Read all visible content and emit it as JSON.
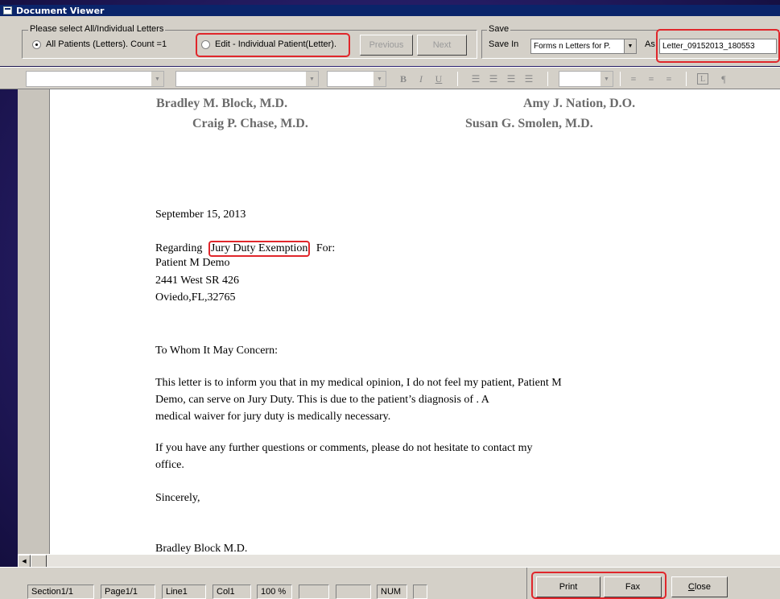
{
  "window": {
    "title": "Document Viewer"
  },
  "options": {
    "select_legend": "Please select All/Individual Letters",
    "all_patients_label": "All Patients (Letters). Count =1",
    "edit_individual_label": "Edit -  Individual Patient(Letter).",
    "previous_label": "Previous",
    "next_label": "Next",
    "save_legend": "Save",
    "save_in_label": "Save In",
    "save_in_value": "Forms n Letters for P.",
    "as_label": "As",
    "as_value": "Letter_09152013_180553"
  },
  "format_toolbar": {
    "bold": "B",
    "italic": "I",
    "underline": "U",
    "pilcrow": "¶"
  },
  "document": {
    "header": {
      "doctor1": "Bradley M. Block, M.D.",
      "doctor2": "Amy J. Nation, D.O.",
      "doctor3": "Craig P. Chase, M.D.",
      "doctor4": "Susan G. Smolen, M.D."
    },
    "date": "September 15, 2013",
    "regarding_prefix": "Regarding",
    "regarding_subject": "Jury Duty Exemption",
    "regarding_suffix": "For:",
    "patient_name": "Patient M Demo",
    "address_line1": "2441 West SR 426",
    "address_line2": "Oviedo,FL,32765",
    "salutation": "To Whom It May Concern:",
    "body1_line1": "This letter is to inform you that in my medical opinion, I do not feel my patient, Patient M",
    "body1_line2": "Demo, can serve on Jury Duty.  This is due to the patient’s diagnosis of              .  A",
    "body1_line3": "medical waiver for jury duty is medically necessary.",
    "body2_line1": "If you have any further questions or comments, please do not hesitate to contact my",
    "body2_line2": "office.",
    "closing": "Sincerely,",
    "signature": "Bradley Block M.D."
  },
  "status": {
    "section": "Section1/1",
    "page": "Page1/1",
    "line": "Line1",
    "col": "Col1",
    "zoom": "100 %",
    "num": "NUM"
  },
  "buttons": {
    "print": "Print",
    "fax": "Fax",
    "close": "Close"
  }
}
